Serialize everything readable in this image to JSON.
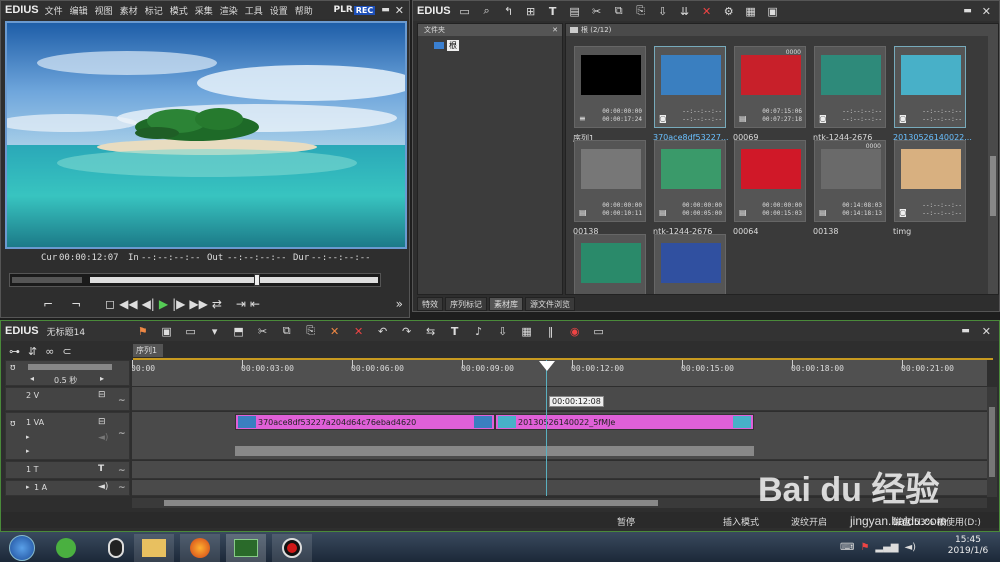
{
  "player": {
    "logo": "EDIUS",
    "menu": [
      "文件",
      "编辑",
      "视图",
      "素材",
      "标记",
      "模式",
      "采集",
      "渲染",
      "工具",
      "设置",
      "帮助"
    ],
    "plr": "PLR",
    "rec": "REC",
    "cur_label": "Cur",
    "cur_value": "00:00:12:07",
    "in_label": "In",
    "in_value": "--:--:--:--",
    "out_label": "Out",
    "out_value": "--:--:--:--",
    "dur_label": "Dur",
    "dur_value": "--:--:--:--",
    "scrub_position": 0.67
  },
  "bin": {
    "logo": "EDIUS",
    "folder_header": "文件夹",
    "root_label": "根",
    "path_label": "根 (2/12)",
    "tabs": [
      "特效",
      "序列标记",
      "素材库",
      "源文件浏览"
    ],
    "active_tab": 2,
    "clips": [
      {
        "label": "序列1",
        "tc1": "00:00:00:00",
        "tc2": "00:00:17:24",
        "badge": "",
        "type": "seq",
        "color": "#000"
      },
      {
        "label": "370ace8df53227...",
        "tc1": "--:--:--:--",
        "tc2": "--:--:--:--",
        "badge": "",
        "type": "img",
        "color": "#3a7fc0",
        "selected": true
      },
      {
        "label": "00069",
        "tc1": "00:07:15:06",
        "tc2": "00:07:27:18",
        "badge": "0000",
        "type": "vid",
        "color": "#c8202a"
      },
      {
        "label": "ntk-1244-2676",
        "tc1": "--:--:--:--",
        "tc2": "--:--:--:--",
        "badge": "",
        "type": "img",
        "color": "#2e8a7a"
      },
      {
        "label": "20130526140022...",
        "tc1": "--:--:--:--",
        "tc2": "--:--:--:--",
        "badge": "",
        "type": "img",
        "color": "#48b0c8",
        "selected": true
      },
      {
        "label": "00138",
        "tc1": "00:00:00:00",
        "tc2": "00:00:10:11",
        "badge": "",
        "type": "vid",
        "color": "#777"
      },
      {
        "label": "ntk-1244-2676",
        "tc1": "00:00:00:00",
        "tc2": "00:00:05:00",
        "badge": "",
        "type": "vid",
        "color": "#3a9a6a"
      },
      {
        "label": "00064",
        "tc1": "00:00:00:00",
        "tc2": "00:00:15:03",
        "badge": "",
        "type": "vid",
        "color": "#d01828"
      },
      {
        "label": "00138",
        "tc1": "00:14:08:03",
        "tc2": "00:14:18:13",
        "badge": "0000",
        "type": "vid",
        "color": "#6a6a6a"
      },
      {
        "label": "timg",
        "tc1": "--:--:--:--",
        "tc2": "--:--:--:--",
        "badge": "",
        "type": "img",
        "color": "#d8b080"
      },
      {
        "label": "",
        "tc1": "--:--:--:--",
        "tc2": "--:--:--:--",
        "badge": "",
        "type": "img",
        "color": "#2a8a6a"
      },
      {
        "label": "",
        "tc1": "--:--:--:--",
        "tc2": "--:--:--:--",
        "badge": "",
        "type": "img",
        "color": "#3050a0"
      }
    ]
  },
  "timeline": {
    "logo": "EDIUS",
    "project": "无标题14",
    "sequence_tab": "序列1",
    "zoom": "0.5 秒",
    "ruler": [
      "00:00",
      "00:00:03:00",
      "00:00:06:00",
      "00:00:09:00",
      "00:00:12:00",
      "00:00:15:00",
      "00:00:18:00",
      "00:00:21:00",
      "00:0"
    ],
    "playhead_tc": "00:00:12:08",
    "tracks": [
      {
        "name": "2 V"
      },
      {
        "name": "1 VA"
      },
      {
        "name": "1 T"
      },
      {
        "name": "1 A"
      }
    ],
    "clips": [
      {
        "name": "370ace8df53227a204d64c76ebad4620"
      },
      {
        "name": "20130526140022_5fMJe"
      }
    ],
    "status": [
      "暂停",
      "插入模式",
      "波纹开启",
      "磁盘:53% 被使用(D:)"
    ]
  },
  "taskbar": {
    "time": "15:45",
    "date": "2019/1/6"
  },
  "watermark": {
    "text": "Bai du 经验",
    "url": "jingyan.baidu.com"
  },
  "colors": {
    "clip_pink": "#e060d8",
    "rec_blue": "#1d4fb8",
    "playhead": "#5ab0c0"
  }
}
